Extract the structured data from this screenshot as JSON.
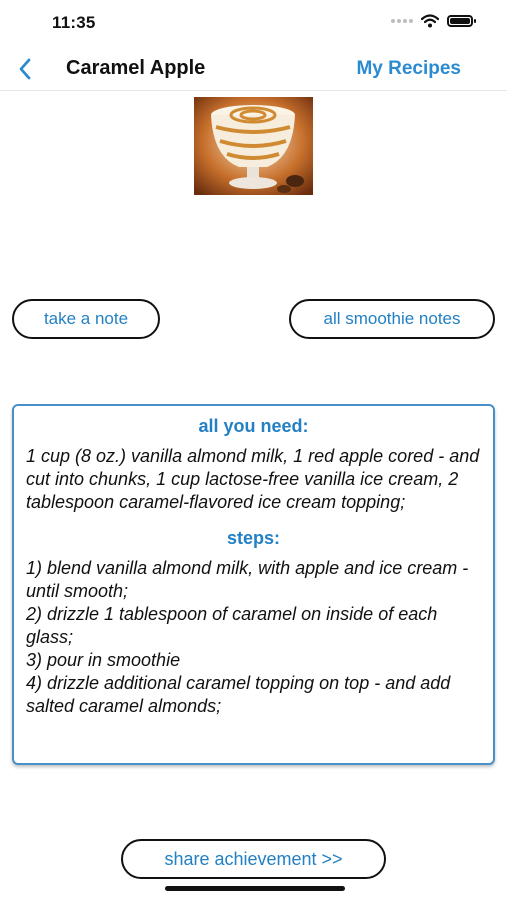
{
  "status_bar": {
    "time": "11:35"
  },
  "nav": {
    "title": "Caramel Apple",
    "right_label": "My Recipes"
  },
  "buttons": {
    "take_note": "take a note",
    "all_notes": "all smoothie notes",
    "share": "share achievement >>"
  },
  "recipe": {
    "ingredients_heading": "all you need:",
    "ingredients": "1 cup (8 oz.) vanilla almond milk, 1 red apple cored - and cut into chunks, 1 cup lactose-free vanilla ice cream, 2 tablespoon caramel-flavored ice cream topping;",
    "steps_heading": "steps:",
    "steps": "1) blend vanilla almond milk, with apple and ice cream - until smooth;\n2) drizzle 1 tablespoon of caramel on inside of each glass;\n3) pour in smoothie\n4) drizzle additional caramel topping on top - and add salted caramel almonds;"
  },
  "icons": {
    "back": "chevron-left-icon",
    "signal": "cellular-signal-icon",
    "wifi": "wifi-icon",
    "battery": "battery-icon"
  },
  "colors": {
    "accent": "#2380c4",
    "card_border": "#4a90c8"
  }
}
